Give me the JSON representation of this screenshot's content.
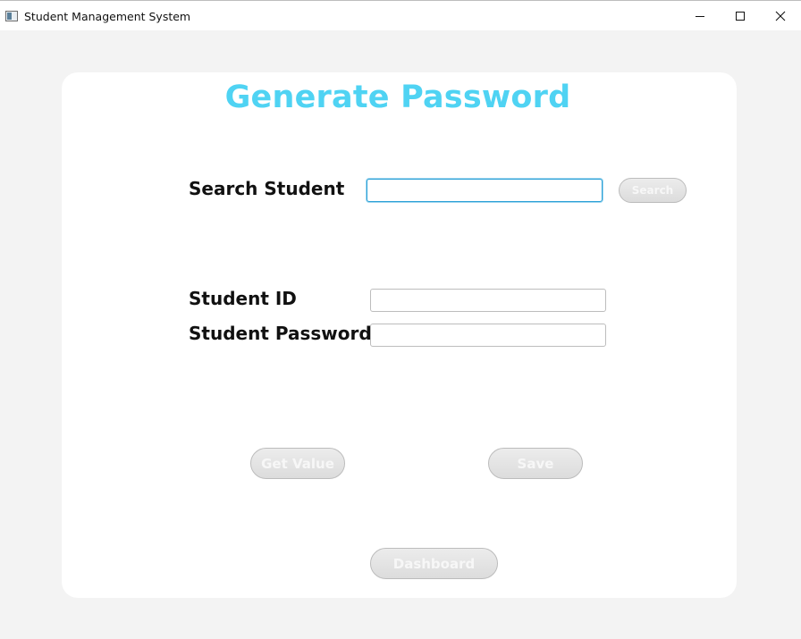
{
  "window": {
    "title": "Student Management System",
    "icon": "app-window-icon",
    "controls": {
      "minimize_icon": "minimize-icon",
      "maximize_icon": "maximize-icon",
      "close_icon": "close-icon"
    }
  },
  "form": {
    "heading": "Generate Password",
    "heading_color": "#4fd3f3",
    "search": {
      "label": "Search Student",
      "value": "",
      "placeholder": "",
      "button_label": "Search"
    },
    "student_id": {
      "label": "Student ID",
      "value": ""
    },
    "student_password": {
      "label": "Student Password",
      "value": ""
    },
    "buttons": {
      "get_value": "Get Value",
      "save": "Save",
      "dashboard": "Dashboard"
    }
  }
}
